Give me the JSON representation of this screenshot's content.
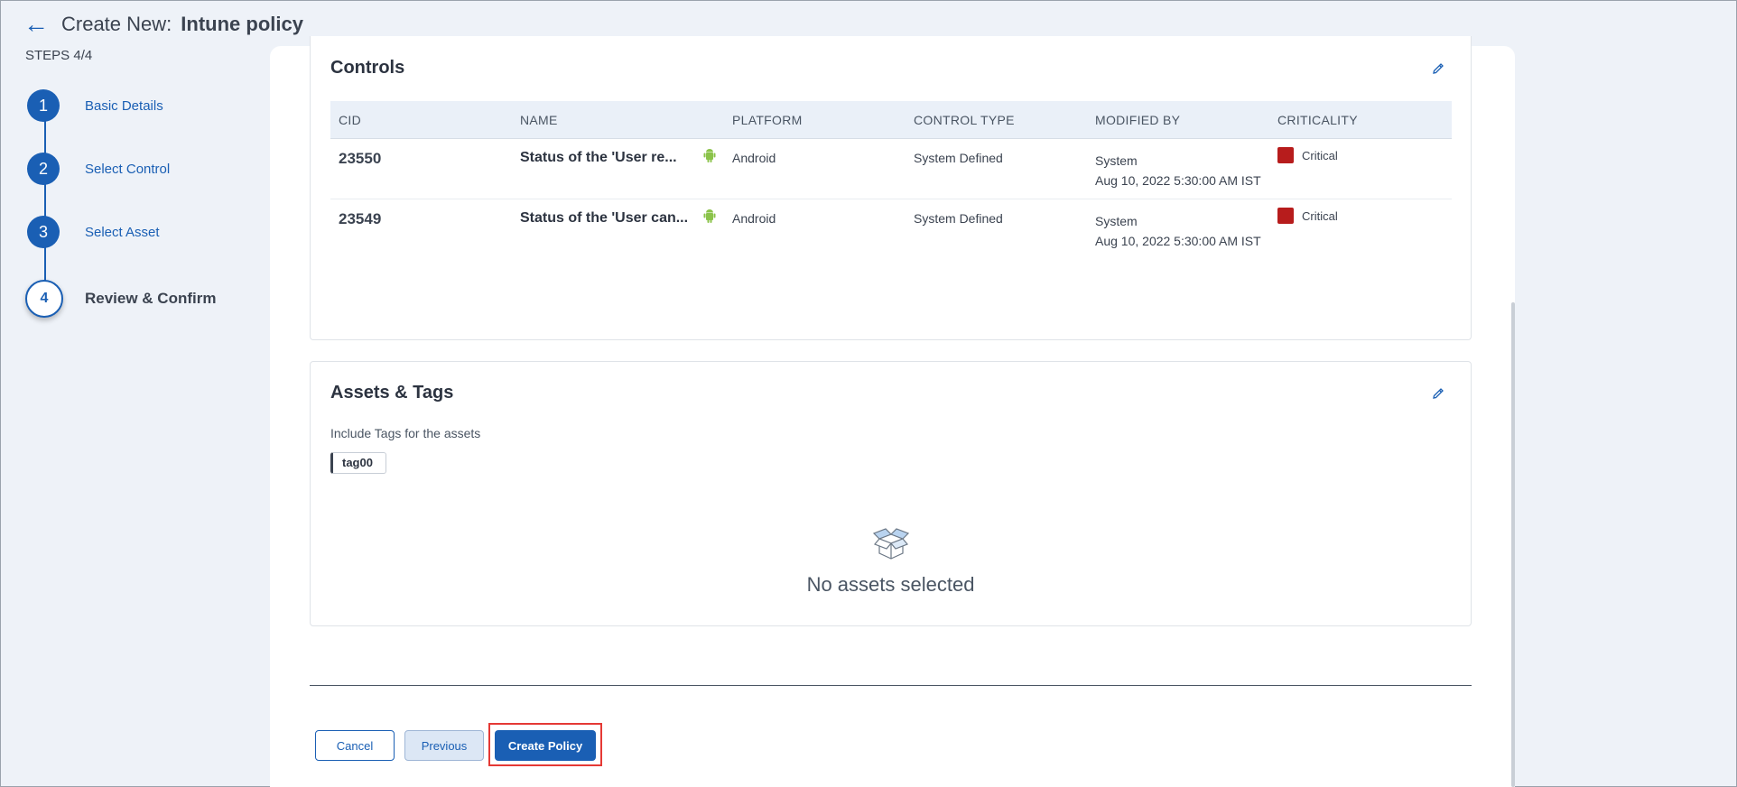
{
  "header": {
    "back_icon": "arrow-left-icon",
    "title_prefix": "Create New:",
    "title_main": "Intune policy"
  },
  "steps": {
    "count_label": "STEPS 4/4",
    "items": [
      {
        "number": "1",
        "label": "Basic Details"
      },
      {
        "number": "2",
        "label": "Select Control"
      },
      {
        "number": "3",
        "label": "Select Asset"
      },
      {
        "number": "4",
        "label": "Review & Confirm"
      }
    ],
    "active_index": 3
  },
  "controls": {
    "title": "Controls",
    "edit_icon": "pencil-icon",
    "columns": {
      "cid": "CID",
      "name": "NAME",
      "platform": "PLATFORM",
      "control_type": "CONTROL TYPE",
      "modified_by": "MODIFIED BY",
      "criticality": "CRITICALITY"
    },
    "rows": [
      {
        "cid": "23550",
        "name": "Status of the 'User re...",
        "platform_icon": "android-icon",
        "platform": "Android",
        "control_type": "System Defined",
        "modified_by": "System",
        "modified_at": "Aug 10, 2022 5:30:00 AM IST",
        "criticality": "Critical",
        "criticality_color": "#b71c1c"
      },
      {
        "cid": "23549",
        "name": "Status of the 'User can...",
        "platform_icon": "android-icon",
        "platform": "Android",
        "control_type": "System Defined",
        "modified_by": "System",
        "modified_at": "Aug 10, 2022 5:30:00 AM IST",
        "criticality": "Critical",
        "criticality_color": "#b71c1c"
      }
    ]
  },
  "assets": {
    "title": "Assets & Tags",
    "edit_icon": "pencil-icon",
    "tags_label": "Include Tags for the assets",
    "tags": [
      "tag00"
    ],
    "empty_icon": "open-box-icon",
    "empty_text": "No assets selected"
  },
  "footer": {
    "cancel_label": "Cancel",
    "previous_label": "Previous",
    "create_label": "Create Policy"
  },
  "colors": {
    "accent": "#1a5fb4",
    "critical": "#b71c1c",
    "android": "#8bc34a",
    "highlight": "#e53935"
  }
}
